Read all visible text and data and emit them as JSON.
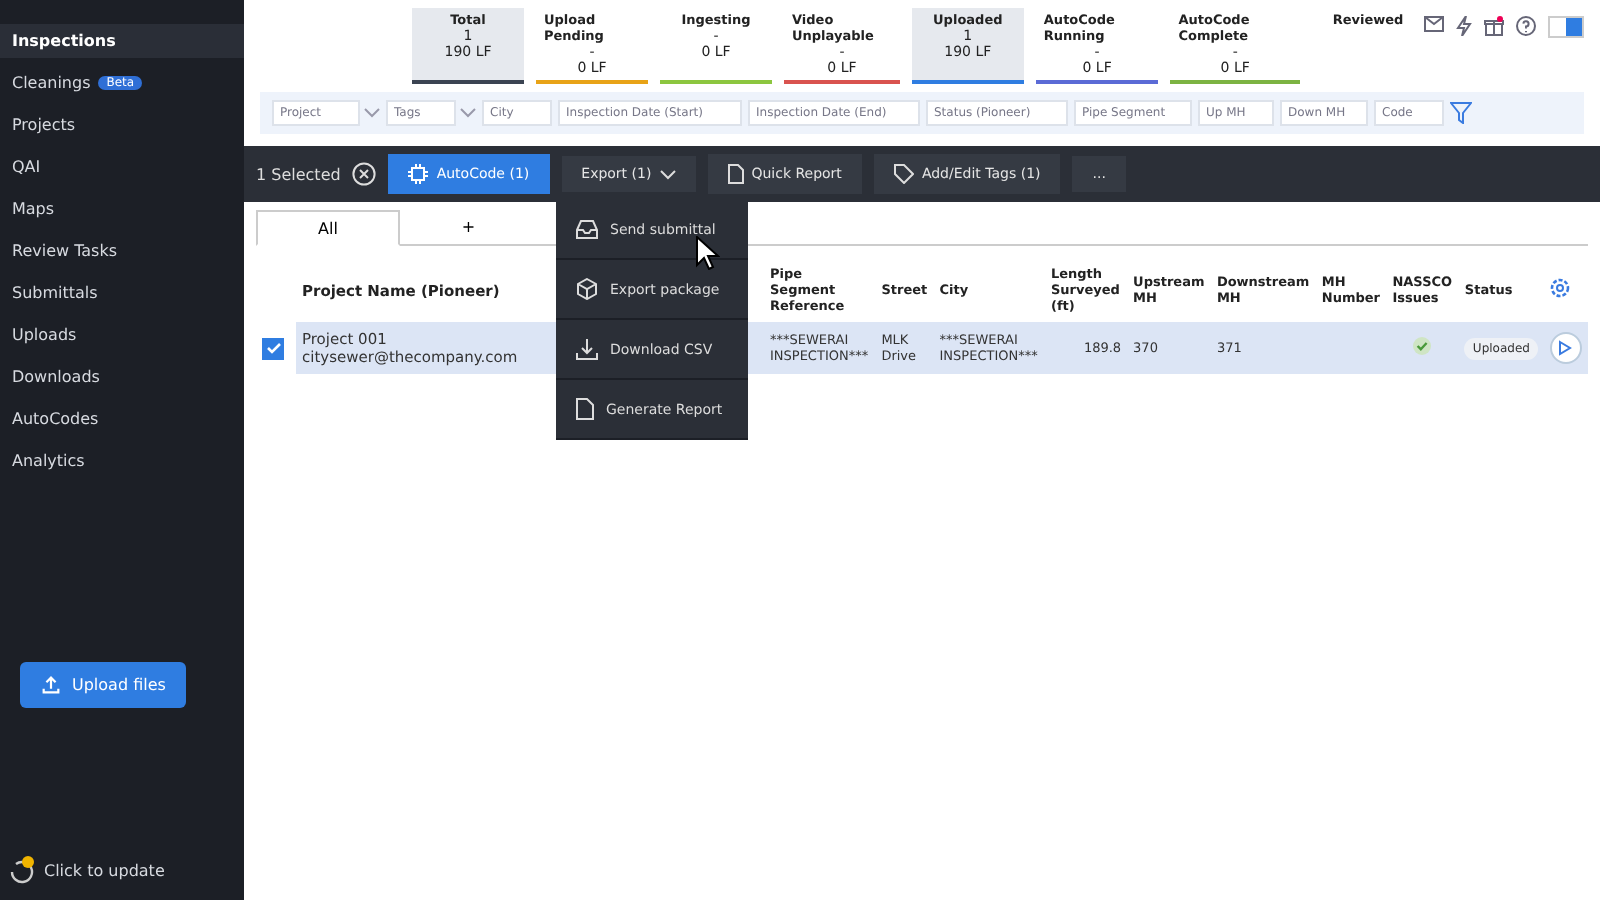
{
  "sidebar": {
    "items": [
      {
        "label": "Inspections",
        "selected": true
      },
      {
        "label": "Cleanings",
        "selected": false,
        "badge": "Beta"
      },
      {
        "label": "Projects",
        "selected": false
      },
      {
        "label": "QAI",
        "selected": false
      },
      {
        "label": "Maps",
        "selected": false
      },
      {
        "label": "Review Tasks",
        "selected": false
      },
      {
        "label": "Submittals",
        "selected": false
      },
      {
        "label": "Uploads",
        "selected": false
      },
      {
        "label": "Downloads",
        "selected": false
      },
      {
        "label": "AutoCodes",
        "selected": false
      },
      {
        "label": "Analytics",
        "selected": false
      }
    ],
    "upload_button": "Upload files",
    "update_link": "Click to update"
  },
  "status_summary": [
    {
      "title": "Total",
      "count": "1",
      "length": "190 LF",
      "selected": true,
      "color": "#3b4452"
    },
    {
      "title": "Upload Pending",
      "count": "-",
      "length": "0 LF",
      "selected": false,
      "color": "#e8a317"
    },
    {
      "title": "Ingesting",
      "count": "-",
      "length": "0 LF",
      "selected": false,
      "color": "#8cc63f"
    },
    {
      "title": "Video Unplayable",
      "count": "-",
      "length": "0 LF",
      "selected": false,
      "color": "#d9534f"
    },
    {
      "title": "Uploaded",
      "count": "1",
      "length": "190 LF",
      "selected": true,
      "color": "#2f7de1"
    },
    {
      "title": "AutoCode Running",
      "count": "-",
      "length": "0 LF",
      "selected": false,
      "color": "#5b6bd6"
    },
    {
      "title": "AutoCode Complete",
      "count": "-",
      "length": "0 LF",
      "selected": false,
      "color": "#7cb342"
    },
    {
      "title": "Reviewed",
      "selected": false
    }
  ],
  "toggle": {
    "on": true
  },
  "filters": [
    {
      "placeholder": "Project",
      "kind": "dropdown"
    },
    {
      "placeholder": "Tags",
      "kind": "dropdown"
    },
    {
      "placeholder": "City",
      "kind": "text"
    },
    {
      "placeholder": "Inspection Date (Start)",
      "kind": "text"
    },
    {
      "placeholder": "Inspection Date (End)",
      "kind": "text"
    },
    {
      "placeholder": "Status (Pioneer)",
      "kind": "text"
    },
    {
      "placeholder": "Pipe Segment",
      "kind": "text"
    },
    {
      "placeholder": "Up MH",
      "kind": "text"
    },
    {
      "placeholder": "Down MH",
      "kind": "text"
    },
    {
      "placeholder": "Code",
      "kind": "text"
    }
  ],
  "toolbar": {
    "selection": "1 Selected",
    "buttons": [
      {
        "label": "AutoCode (1)",
        "kind": "primary"
      },
      {
        "label": "Export (1)",
        "kind": "dropdown"
      },
      {
        "label": "Quick Report",
        "kind": "report"
      },
      {
        "label": "Add/Edit Tags (1)",
        "kind": "tags"
      },
      {
        "label": "...",
        "kind": "more"
      }
    ]
  },
  "tabs": [
    {
      "label": "All",
      "selected": true
    },
    {
      "label": "+",
      "selected": false
    }
  ],
  "export_menu": [
    {
      "label": "Send submittal",
      "kind": "send"
    },
    {
      "label": "Export package",
      "kind": "package"
    },
    {
      "label": "Download CSV",
      "kind": "download"
    },
    {
      "label": "Generate Report",
      "kind": "report"
    }
  ],
  "table": {
    "columns": [
      "Project Name (Pioneer)",
      "Pipe Segment Reference",
      "Street",
      "City",
      "Length Surveyed (ft)",
      "Upstream MH",
      "Downstream MH",
      "MH Number",
      "NASSCO Issues",
      "Status"
    ],
    "rows": [
      {
        "selected": true,
        "project": "Project 001",
        "email": "citysewer@thecompany.com",
        "pipe_segment": "***SEWERAI INSPECTION***",
        "street": "MLK Drive",
        "city": "***SEWERAI INSPECTION***",
        "length": "189.8",
        "upstream_mh": "370",
        "downstream_mh": "371",
        "nassco_ok": true,
        "status": "Uploaded"
      }
    ]
  }
}
